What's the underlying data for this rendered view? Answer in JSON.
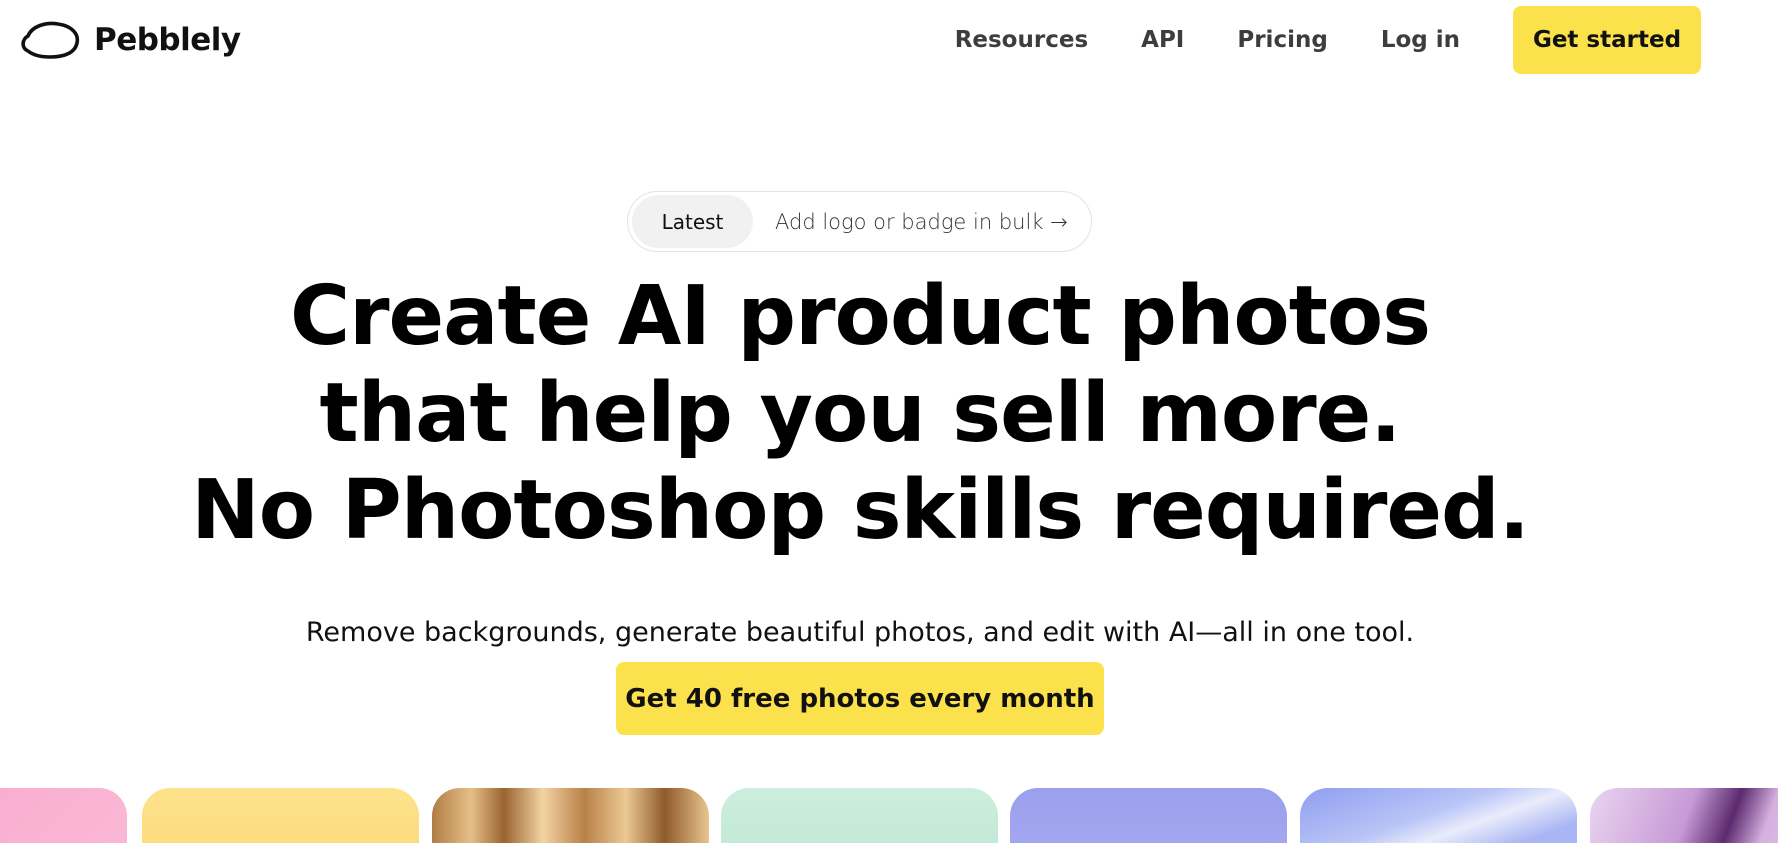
{
  "brand": {
    "name": "Pebblely",
    "logo_icon": "pebble-outline-icon"
  },
  "nav": {
    "links": [
      {
        "label": "Resources"
      },
      {
        "label": "API"
      },
      {
        "label": "Pricing"
      },
      {
        "label": "Log in"
      }
    ],
    "cta_label": "Get started",
    "cta_color": "#fbe14b"
  },
  "announcement": {
    "tag": "Latest",
    "text": "Add logo or badge in bulk →"
  },
  "hero": {
    "headline_lines": [
      "Create AI product photos",
      "that help you sell more.",
      "No Photoshop skills required."
    ],
    "subtitle": "Remove backgrounds, generate beautiful photos, and edit with AI—all in one tool.",
    "cta_label": "Get 40 free photos every month"
  },
  "gallery": {
    "cards": [
      {
        "name": "pink"
      },
      {
        "name": "yellow"
      },
      {
        "name": "gold-curtain"
      },
      {
        "name": "mint"
      },
      {
        "name": "periwinkle"
      },
      {
        "name": "sky-clouds"
      },
      {
        "name": "purple-silk"
      }
    ]
  }
}
